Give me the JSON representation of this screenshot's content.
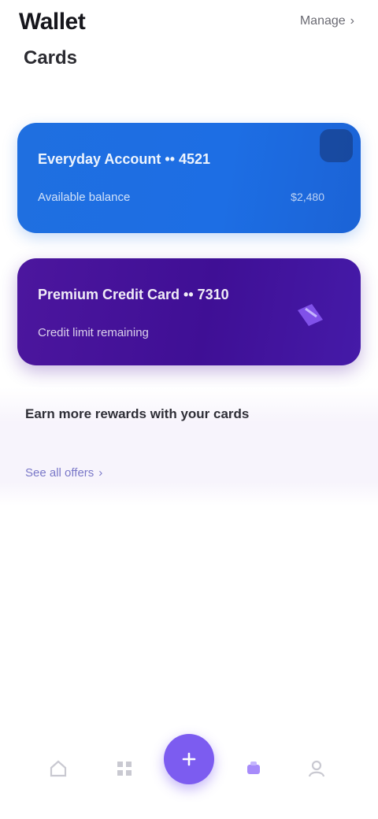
{
  "header": {
    "title": "Wallet",
    "subtitle": "Cards",
    "action_label": "Manage"
  },
  "cards": [
    {
      "line1": "Everyday Account •• 4521",
      "line2": "Available balance",
      "amount": "$2,480",
      "color": "#1f6fe0"
    },
    {
      "line1": "Premium Credit Card •• 7310",
      "line2": "Credit limit remaining",
      "color": "#4c169e"
    }
  ],
  "promo": {
    "title": "Earn more rewards with your cards",
    "link_label": "See all offers"
  },
  "bottom_nav": {
    "items": [
      "home-icon",
      "grid-icon",
      "plus-icon",
      "chart-icon",
      "profile-icon"
    ],
    "accent": "#7c5cf0"
  }
}
